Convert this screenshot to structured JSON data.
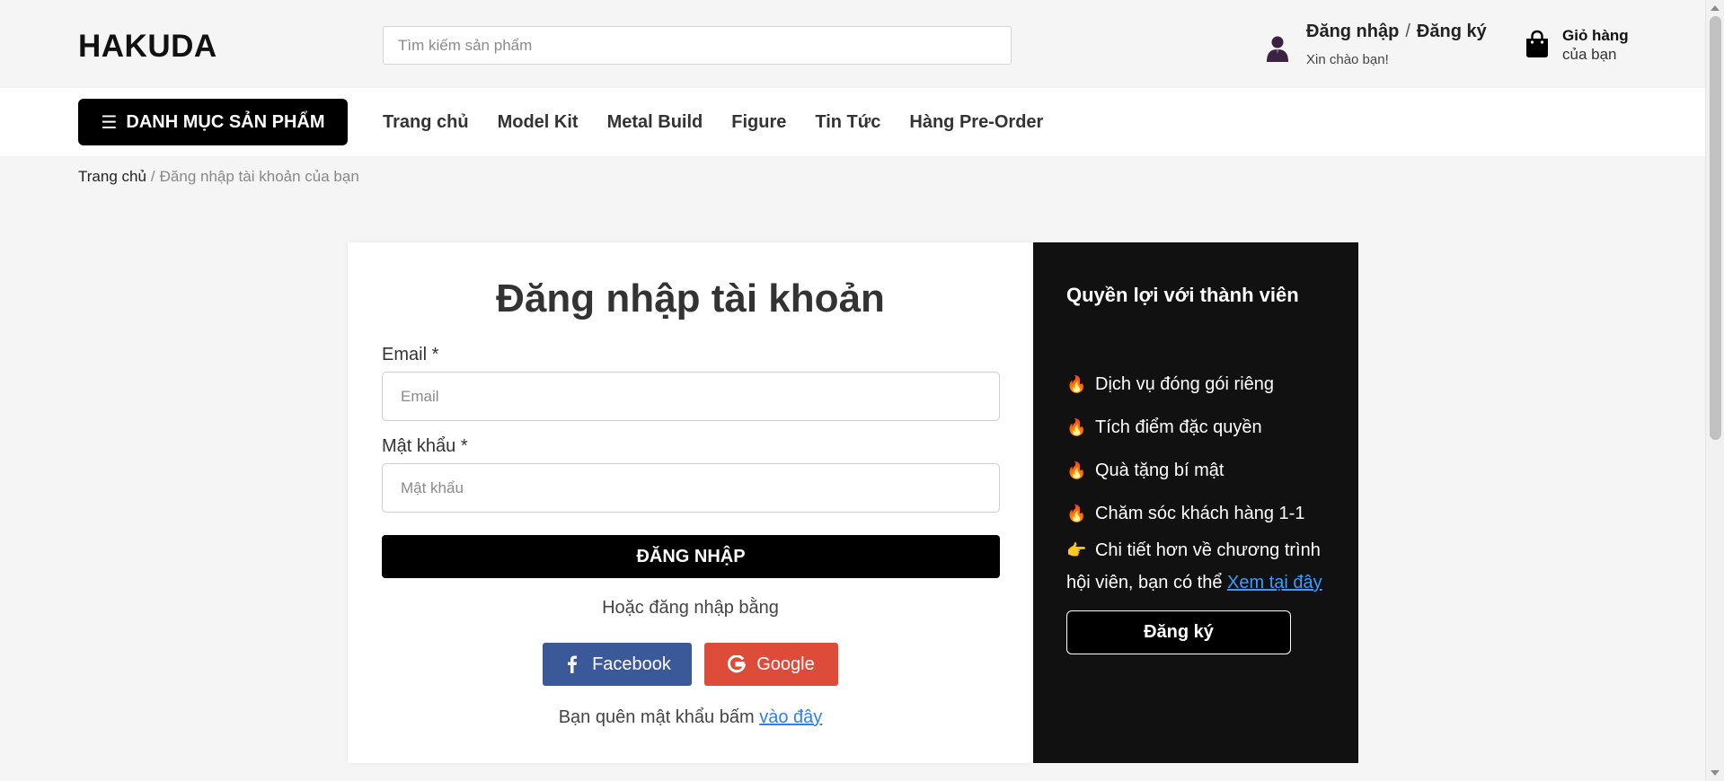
{
  "header": {
    "logo": "HAKUDA",
    "search_placeholder": "Tìm kiếm sản phẩm",
    "account": {
      "login": "Đăng nhập",
      "separator": "/",
      "register": "Đăng ký",
      "greeting": "Xin chào bạn!",
      "icon": "user-icon"
    },
    "cart": {
      "title": "Giỏ hàng",
      "subtitle": "của bạn",
      "icon": "shopping-bag-icon"
    }
  },
  "nav": {
    "category_button": "DANH MỤC SẢN PHẨM",
    "category_icon": "☰",
    "items": [
      "Trang chủ",
      "Model Kit",
      "Metal Build",
      "Figure",
      "Tin Tức",
      "Hàng Pre-Order"
    ]
  },
  "breadcrumb": {
    "home": "Trang chủ",
    "separator": "/",
    "current": "Đăng nhập tài khoản của bạn"
  },
  "login": {
    "title": "Đăng nhập tài khoản",
    "email_label": "Email *",
    "email_placeholder": "Email",
    "password_label": "Mật khẩu *",
    "password_placeholder": "Mật khẩu",
    "submit": "ĐĂNG NHẬP",
    "alt_text": "Hoặc đăng nhập bằng",
    "facebook": "Facebook",
    "google": "Google",
    "forgot_text": "Bạn quên mật khẩu bấm",
    "forgot_link": "vào đây"
  },
  "benefits": {
    "title": "Quyền lợi với thành viên",
    "item_icon": "🔥",
    "items": [
      "Dịch vụ đóng gói riêng",
      "Tích điểm đặc quyền",
      "Quà tặng bí mật",
      "Chăm sóc khách hàng 1-1"
    ],
    "detail_icon": "👉",
    "detail_text": "Chi tiết hơn về chương trình hội viên, bạn có thể",
    "detail_link": "Xem tại đây",
    "register_button": "Đăng ký"
  },
  "colors": {
    "page_bg": "#f5f5f5",
    "primary_button": "#000000",
    "facebook": "#3b5998",
    "google": "#dd4b39",
    "link": "#2f80ed",
    "benefits_bg": "#111111"
  }
}
